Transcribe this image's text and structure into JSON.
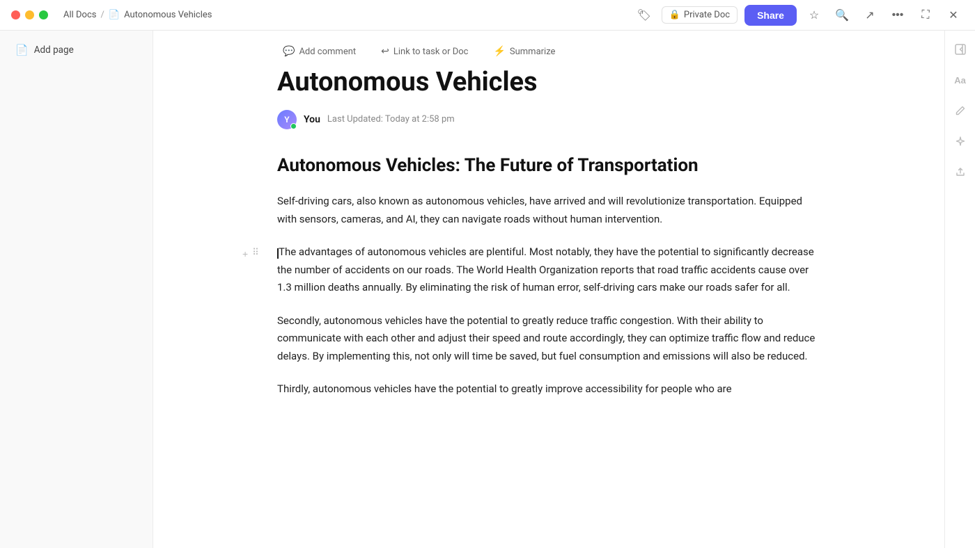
{
  "window": {
    "title": "Autonomous Vehicles"
  },
  "titlebar": {
    "all_docs": "All Docs",
    "separator": "/",
    "doc_title": "Autonomous Vehicles",
    "private_label": "Private Doc",
    "share_label": "Share"
  },
  "toolbar": {
    "add_comment": "Add comment",
    "link_task": "Link to task or Doc",
    "summarize": "Summarize"
  },
  "sidebar": {
    "add_page": "Add page"
  },
  "doc": {
    "title": "Autonomous Vehicles",
    "heading": "Autonomous Vehicles: The Future of Transportation",
    "author": "You",
    "last_updated": "Last Updated: Today at 2:58 pm",
    "paragraphs": [
      "Self-driving cars, also known as autonomous vehicles, have arrived and will revolutionize transportation. Equipped with sensors, cameras, and AI, they can navigate roads without human intervention.",
      "The advantages of autonomous vehicles are plentiful. Most notably, they have the potential to significantly decrease the number of accidents on our roads. The World Health Organization reports that road traffic accidents cause over 1.3 million deaths annually. By eliminating the risk of human error, self-driving cars make our roads safer for all.",
      "Secondly, autonomous vehicles have the potential to greatly reduce traffic congestion. With their ability to communicate with each other and adjust their speed and route accordingly, they can optimize traffic flow and reduce delays. By implementing this, not only will time be saved, but fuel consumption and emissions will also be reduced.",
      "Thirdly, autonomous vehicles have the potential to greatly improve accessibility for people who are"
    ]
  },
  "right_sidebar": {
    "icons": [
      "collapse",
      "font-size",
      "share-alt",
      "sparkles",
      "upload"
    ]
  }
}
